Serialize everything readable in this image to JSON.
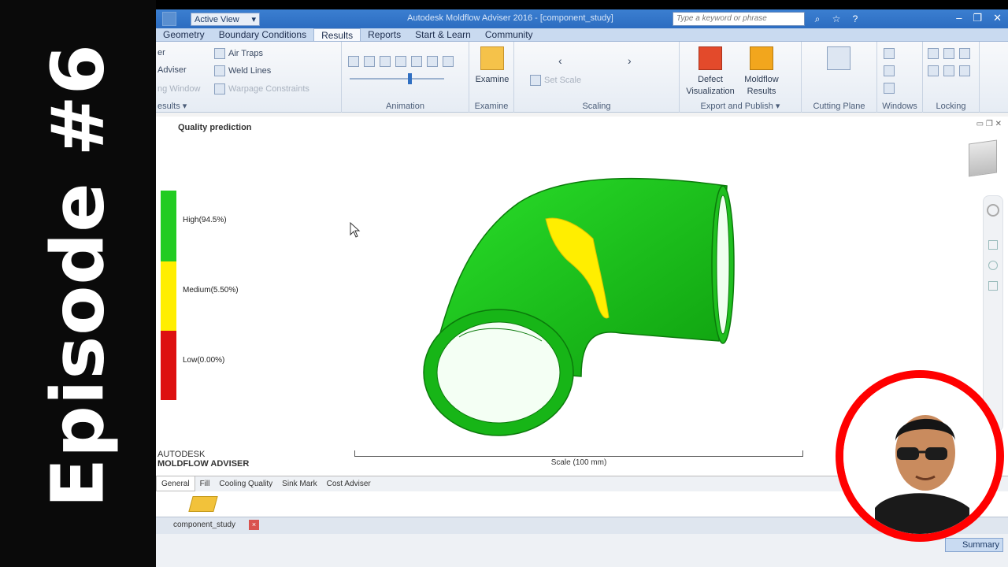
{
  "banner": {
    "text": "Episode #6"
  },
  "window": {
    "title": "Autodesk Moldflow Adviser 2016 - [component_study]",
    "active_view": "Active View",
    "search_placeholder": "Type a keyword or phrase"
  },
  "tabs": [
    "Geometry",
    "Boundary Conditions",
    "Results",
    "Reports",
    "Start & Learn",
    "Community"
  ],
  "active_tab": "Results",
  "ribbon": {
    "results_items": [
      "er",
      "Adviser",
      "ng Window"
    ],
    "air_traps": "Air Traps",
    "weld_lines": "Weld Lines",
    "warpage_constraints": "Warpage Constraints",
    "results_label": "esults",
    "animation_label": "Animation",
    "examine_button": "Examine",
    "examine_label": "Examine",
    "set_scale": "Set Scale",
    "scaling_label": "Scaling",
    "defect_visualization": [
      "Defect",
      "Visualization"
    ],
    "moldflow_results": [
      "Moldflow",
      "Results"
    ],
    "export_label": "Export and Publish",
    "cutting_plane_label": "Cutting Plane",
    "windows_label": "Windows",
    "locking_label": "Locking"
  },
  "viewport": {
    "title": "Quality prediction",
    "legend": [
      {
        "label": "High(94.5%)",
        "color": "#22cc22",
        "fraction": 0.945
      },
      {
        "label": "Medium(5.50%)",
        "color": "#ffee00",
        "fraction": 0.055
      },
      {
        "label": "Low(0.00%)",
        "color": "#dd1111",
        "fraction": 0.0
      }
    ],
    "brand_line1": "AUTODESK",
    "brand_line2": "MOLDFLOW ADVISER",
    "scale_label": "Scale (100 mm)"
  },
  "bottom_tabs": [
    "General",
    "Fill",
    "Cooling Quality",
    "Sink Mark",
    "Cost Adviser"
  ],
  "active_bottom_tab": "General",
  "study_tab": "component_study",
  "summary_button": "Summary",
  "colors": {
    "part_green": "#22cc22",
    "defect_yellow": "#ffee00",
    "ring_red": "#ff0000"
  }
}
